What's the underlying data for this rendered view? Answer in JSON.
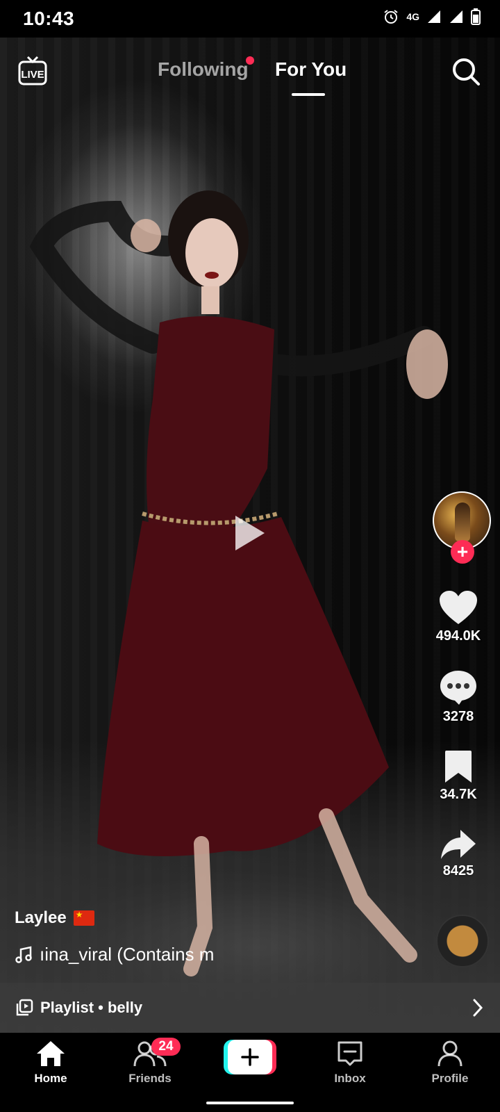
{
  "status_bar": {
    "time": "10:43",
    "network": "4G",
    "icons": [
      "alarm-icon",
      "network-4g-icon",
      "signal-icon",
      "signal-icon",
      "battery-icon"
    ]
  },
  "top_nav": {
    "live_label": "LIVE",
    "tabs": [
      {
        "label": "Following",
        "active": false,
        "has_dot": true
      },
      {
        "label": "For You",
        "active": true
      }
    ],
    "search_icon": "search-icon"
  },
  "video": {
    "state": "paused",
    "creator": {
      "username": "Laylee",
      "flag": "China flag"
    },
    "sound": "ıina_viral (Contains m",
    "actions": {
      "likes": "494.0K",
      "comments": "3278",
      "saves": "34.7K",
      "shares": "8425"
    }
  },
  "playlist": {
    "label": "Playlist • belly"
  },
  "bottom_nav": {
    "items": [
      {
        "label": "Home",
        "active": true
      },
      {
        "label": "Friends",
        "badge": "24"
      },
      {
        "label": "Create"
      },
      {
        "label": "Inbox"
      },
      {
        "label": "Profile"
      }
    ]
  },
  "colors": {
    "accent": "#fe2c55",
    "cyan": "#25f4ee"
  }
}
